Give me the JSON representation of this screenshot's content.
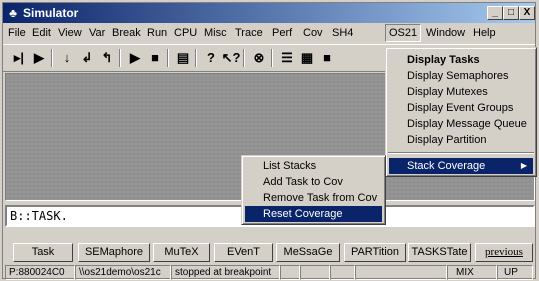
{
  "window": {
    "title": "Simulator",
    "minimize": "_",
    "restore": "□",
    "close": "X"
  },
  "menubar": [
    "File",
    "Edit",
    "View",
    "Var",
    "Break",
    "Run",
    "CPU",
    "Misc",
    "Trace",
    "Perf",
    "Cov",
    "SH4",
    "OS21",
    "Window",
    "Help"
  ],
  "toolbar_icons": [
    "step-into-icon",
    "step-over-icon",
    "step-down-icon",
    "step-back-icon",
    "return-icon",
    "go-icon",
    "break-icon",
    "list-icon",
    "help-icon",
    "context-help-icon",
    "stop-icon",
    "registers-icon",
    "memory-icon",
    "window-icon"
  ],
  "command_line": {
    "value": "B::TASK."
  },
  "softkeys": [
    "Task",
    "SEMaphore",
    "MuTeX",
    "EVenT",
    "MeSsaGe",
    "PARTition",
    "TASKSTate",
    "previous"
  ],
  "status": {
    "address": "P:880024C0",
    "path": "\\\\os21demo\\os21c",
    "state": "stopped at breakpoint",
    "mode": "MIX",
    "direction": "UP"
  },
  "os21_menu": {
    "items": [
      {
        "label": "Display Tasks",
        "bold": true
      },
      {
        "label": "Display Semaphores"
      },
      {
        "label": "Display Mutexes"
      },
      {
        "label": "Display Event Groups"
      },
      {
        "label": "Display Message Queue"
      },
      {
        "label": "Display Partition"
      }
    ],
    "submenu_item": "Stack Coverage"
  },
  "stack_coverage_menu": {
    "items": [
      "List Stacks",
      "Add Task to Cov",
      "Remove Task from Cov",
      "Reset Coverage"
    ],
    "selected_index": 3
  },
  "colors": {
    "selection": "#0a246a",
    "face": "#d4d0c8",
    "workarea": "#909090"
  }
}
